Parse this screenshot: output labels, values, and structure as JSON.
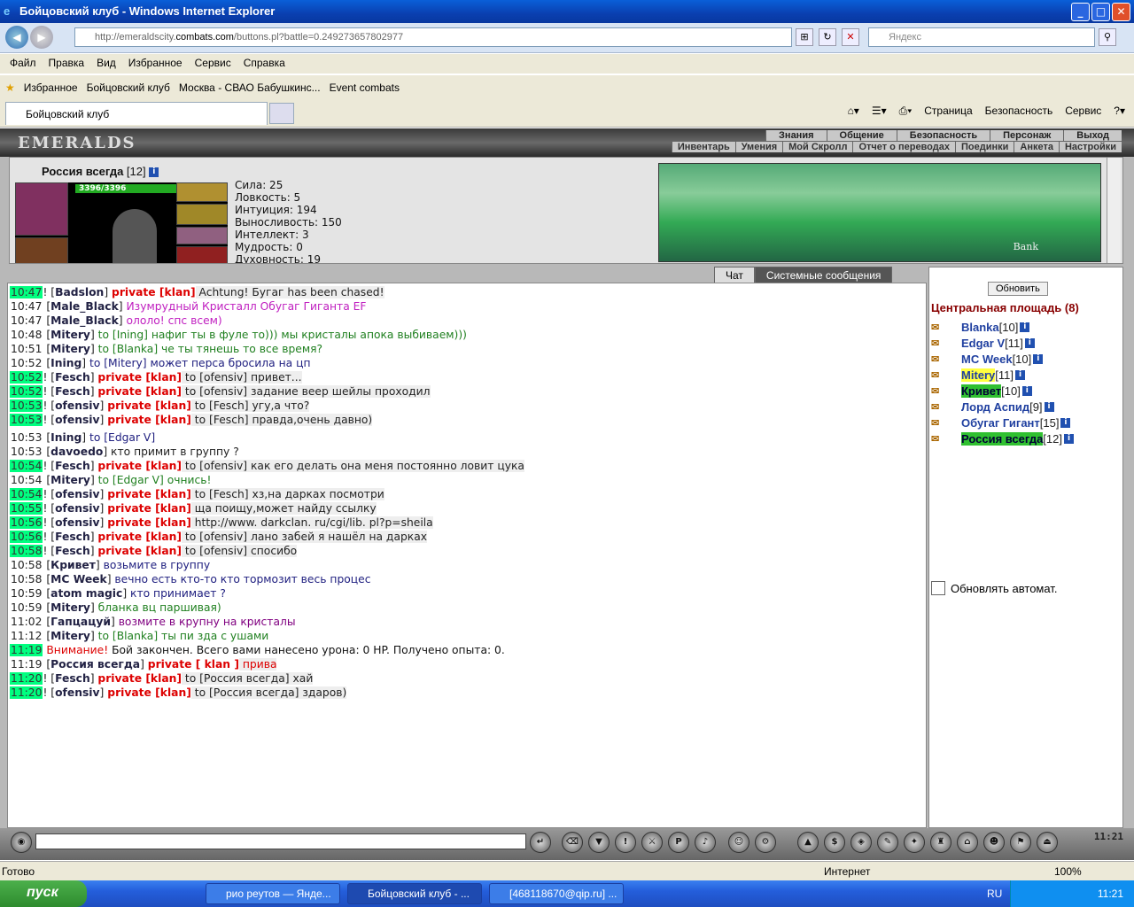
{
  "window": {
    "title": "Бойцовский клуб - Windows Internet Explorer"
  },
  "address": {
    "url_prefix": "http://emeraldscity.",
    "url_domain": "combats.com",
    "url_suffix": "/buttons.pl?battle=0.249273657802977",
    "search_placeholder": "Яндекс"
  },
  "menu": [
    "Файл",
    "Правка",
    "Вид",
    "Избранное",
    "Сервис",
    "Справка"
  ],
  "favorites": {
    "label": "Избранное",
    "items": [
      "Бойцовский клуб",
      "Москва - СВАО Бабушкинс...",
      "Event combats"
    ]
  },
  "tabs": {
    "active": "Бойцовский клуб"
  },
  "commandbar": [
    "Страница",
    "Безопасность",
    "Сервис"
  ],
  "game": {
    "logo": "EMERALDS",
    "topmenu": [
      "Знания",
      "Общение",
      "Безопасность",
      "Персонаж",
      "Выход"
    ],
    "submenu": [
      "Инвентарь",
      "Умения",
      "Мой Скролл",
      "Отчет о переводах",
      "Поединки",
      "Анкета",
      "Настройки"
    ],
    "character": {
      "name": "Россия всегда",
      "level": "[12]",
      "hp": "3396/3396"
    },
    "stats": [
      "Сила: 25",
      "Ловкость: 5",
      "Интуиция: 194",
      "Выносливость: 150",
      "Интеллект: 3",
      "Мудрость: 0",
      "Духовность: 19"
    ],
    "bank_caption": "Bank",
    "chat_tabs": [
      "Чат",
      "Системные сообщения"
    ],
    "refresh_label": "Обновить",
    "room_title": "Центральная площадь (8)",
    "auto_refresh_label": "Обновлять автомат.",
    "users": [
      {
        "name": "Blanka",
        "level": "[10]",
        "style": ""
      },
      {
        "name": "Edgar V",
        "level": "[11]",
        "style": ""
      },
      {
        "name": "MC Week",
        "level": "[10]",
        "style": ""
      },
      {
        "name": "Mitery",
        "level": "[11]",
        "style": "y"
      },
      {
        "name": "Кривет",
        "level": "[10]",
        "style": "g"
      },
      {
        "name": "Лорд Аспид",
        "level": "[9]",
        "style": ""
      },
      {
        "name": "Обугаг Гигант",
        "level": "[15]",
        "style": ""
      },
      {
        "name": "Россия всегда",
        "level": "[12]",
        "style": "g"
      }
    ],
    "clock": "11:21"
  },
  "chat": [
    {
      "t": "10:47",
      "hl": true,
      "nick": "Badslon",
      "priv": "private [klan]",
      "text": " Achtung! Бугаг has been chased!",
      "color": "#222"
    },
    {
      "t": "10:47",
      "hl": false,
      "nick": "Male_Black",
      "priv": "",
      "text": " Изумрудный Кристалл Обугаг Гиганта EF",
      "color": "#c020c0"
    },
    {
      "t": "10:47",
      "hl": false,
      "nick": "Male_Black",
      "priv": "",
      "text": " ололо! спс всем)",
      "color": "#c020c0"
    },
    {
      "t": "10:48",
      "hl": false,
      "nick": "Mitery",
      "priv": "",
      "text": " to [Ining] нафиг ты в фуле то))) мы кристалы апока выбиваем)))",
      "color": "#208020"
    },
    {
      "t": "10:51",
      "hl": false,
      "nick": "Mitery",
      "priv": "",
      "text": " to [Blanka] че ты тянешь то все время?",
      "color": "#208020"
    },
    {
      "t": "10:52",
      "hl": false,
      "nick": "Ining",
      "priv": "",
      "text": " to [Mitery] может перса бросила на цп",
      "color": "#202080"
    },
    {
      "t": "10:52",
      "hl": true,
      "nick": "Fesch",
      "priv": "private [klan]",
      "text": " to [ofensiv] привет...",
      "color": "#222"
    },
    {
      "t": "10:52",
      "hl": true,
      "nick": "Fesch",
      "priv": "private [klan]",
      "text": " to [ofensiv] задание веер шейлы проходил",
      "color": "#222"
    },
    {
      "t": "10:53",
      "hl": true,
      "nick": "ofensiv",
      "priv": "private [klan]",
      "text": " to [Fesch] угу,а что?",
      "color": "#222"
    },
    {
      "t": "10:53",
      "hl": true,
      "nick": "ofensiv",
      "priv": "private [klan]",
      "text": " to [Fesch] правда,очень давно)",
      "color": "#222"
    },
    {
      "t": "10:53",
      "hl": false,
      "nick": "Ining",
      "priv": "",
      "text": " to [Edgar V]",
      "color": "#202080",
      "gap": true
    },
    {
      "t": "10:53",
      "hl": false,
      "nick": "davoedo",
      "priv": "",
      "text": " кто примит в группу ?",
      "color": "#222"
    },
    {
      "t": "10:54",
      "hl": true,
      "nick": "Fesch",
      "priv": "private [klan]",
      "text": " to [ofensiv] как его делать она меня постоянно ловит цука",
      "color": "#222"
    },
    {
      "t": "10:54",
      "hl": false,
      "nick": "Mitery",
      "priv": "",
      "text": " to [Edgar V] очнись!",
      "color": "#208020"
    },
    {
      "t": "10:54",
      "hl": true,
      "nick": "ofensiv",
      "priv": "private [klan]",
      "text": " to [Fesch] хз,на дарках посмотри",
      "color": "#222"
    },
    {
      "t": "10:55",
      "hl": true,
      "nick": "ofensiv",
      "priv": "private [klan]",
      "text": " ща поищу,может найду ссылку",
      "color": "#222"
    },
    {
      "t": "10:56",
      "hl": true,
      "nick": "ofensiv",
      "priv": "private [klan]",
      "text": " http://www. darkclan. ru/cgi/lib. pl?p=sheila",
      "color": "#222"
    },
    {
      "t": "10:56",
      "hl": true,
      "nick": "Fesch",
      "priv": "private [klan]",
      "text": " to [ofensiv] лано забей я нашёл на дарках",
      "color": "#222"
    },
    {
      "t": "10:58",
      "hl": true,
      "nick": "Fesch",
      "priv": "private [klan]",
      "text": " to [ofensiv] спосибо",
      "color": "#222"
    },
    {
      "t": "10:58",
      "hl": false,
      "nick": "Кривет",
      "priv": "",
      "text": " возьмите в группу",
      "color": "#202080"
    },
    {
      "t": "10:58",
      "hl": false,
      "nick": "MC Week",
      "priv": "",
      "text": " вечно есть кто-то кто тормозит весь процес",
      "color": "#202080"
    },
    {
      "t": "10:59",
      "hl": false,
      "nick": "atom magic",
      "priv": "",
      "text": " кто принимает ?",
      "color": "#202080"
    },
    {
      "t": "10:59",
      "hl": false,
      "nick": "Mitery",
      "priv": "",
      "text": " бланка вц паршивая)",
      "color": "#208020"
    },
    {
      "t": "11:02",
      "hl": false,
      "nick": "Гапцацуй",
      "priv": "",
      "text": " возмите в крупну на кристалы",
      "color": "#800080"
    },
    {
      "t": "11:12",
      "hl": false,
      "nick": "Mitery",
      "priv": "",
      "text": " to [Blanka] ты пи зда с ушами",
      "color": "#208020"
    },
    {
      "t": "11:19",
      "hl": true,
      "sys": "Внимание!",
      "text": " Бой закончен. Всего вами нанесено урона: 0 HP. Получено опыта: 0.",
      "color": "#111"
    },
    {
      "t": "11:19",
      "hl": false,
      "nick": "Россия всегда",
      "priv": "private [ klan ]",
      "text": " прива",
      "color": "#d00"
    },
    {
      "t": "11:20",
      "hl": true,
      "nick": "Fesch",
      "priv": "private [klan]",
      "text": " to [Россия всегда] хай",
      "color": "#222"
    },
    {
      "t": "11:20",
      "hl": true,
      "nick": "ofensiv",
      "priv": "private [klan]",
      "text": " to [Россия всегда] здаров)",
      "color": "#222"
    }
  ],
  "status": {
    "left": "Готово",
    "zone": "Интернет",
    "zoom": "100%"
  },
  "taskbar": {
    "start": "пуск",
    "tasks": [
      "рио реутов — Янде...",
      "Бойцовский клуб - ...",
      "[468118670@qip.ru] ..."
    ],
    "lang": "RU",
    "time": "11:21"
  }
}
